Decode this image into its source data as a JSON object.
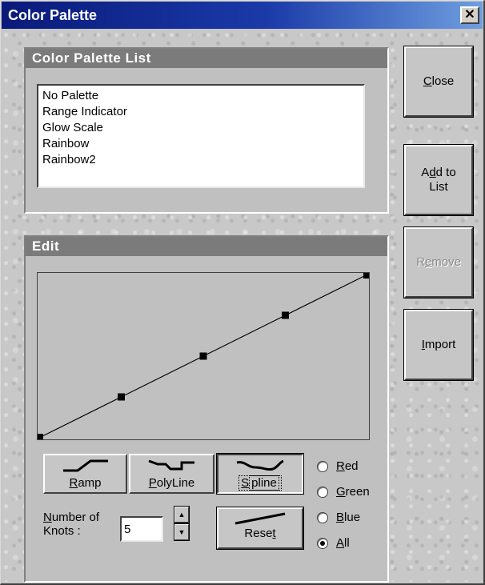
{
  "window": {
    "title": "Color Palette",
    "close_glyph": "✕"
  },
  "palette_list": {
    "header": "Color Palette List",
    "items": [
      "No Palette",
      "Range Indicator",
      "Glow Scale",
      "Rainbow",
      "Rainbow2"
    ]
  },
  "side_buttons": {
    "close": {
      "pre": "",
      "mnemonic": "C",
      "post": "lose"
    },
    "add": {
      "pre": "A",
      "mnemonic": "d",
      "post": "d to",
      "line2": "List"
    },
    "remove": {
      "pre": "R",
      "mnemonic": "e",
      "post": "move",
      "disabled": true
    },
    "import": {
      "pre": "",
      "mnemonic": "I",
      "post": "mport"
    }
  },
  "edit": {
    "header": "Edit",
    "curve": {
      "knots": [
        [
          0,
          0
        ],
        [
          0.25,
          0.25
        ],
        [
          0.5,
          0.5
        ],
        [
          0.75,
          0.75
        ],
        [
          1,
          1
        ]
      ]
    },
    "modes": {
      "ramp": {
        "mnemonic": "R",
        "rest": "amp"
      },
      "polyline": {
        "mnemonic": "P",
        "rest": "olyLine"
      },
      "spline": {
        "mnemonic": "S",
        "rest": "pline",
        "pressed": true
      }
    },
    "channels": {
      "red": {
        "mnemonic": "R",
        "rest": "ed",
        "checked": false
      },
      "green": {
        "mnemonic": "G",
        "rest": "reen",
        "checked": false
      },
      "blue": {
        "mnemonic": "B",
        "rest": "lue",
        "checked": false
      },
      "all": {
        "mnemonic": "A",
        "rest": "ll",
        "checked": true
      }
    },
    "knots": {
      "label_line1_mnemonic": "N",
      "label_line1_rest": "umber of",
      "label_line2": "Knots :",
      "value": "5"
    },
    "reset": {
      "pre": "Rese",
      "mnemonic": "t",
      "post": ""
    }
  },
  "icons": {
    "close": "close-icon",
    "spin_up": "up-arrow-icon",
    "spin_down": "down-arrow-icon",
    "ramp": "ramp-curve-icon",
    "polyline": "polyline-curve-icon",
    "spline": "spline-curve-icon",
    "reset": "reset-line-icon"
  }
}
